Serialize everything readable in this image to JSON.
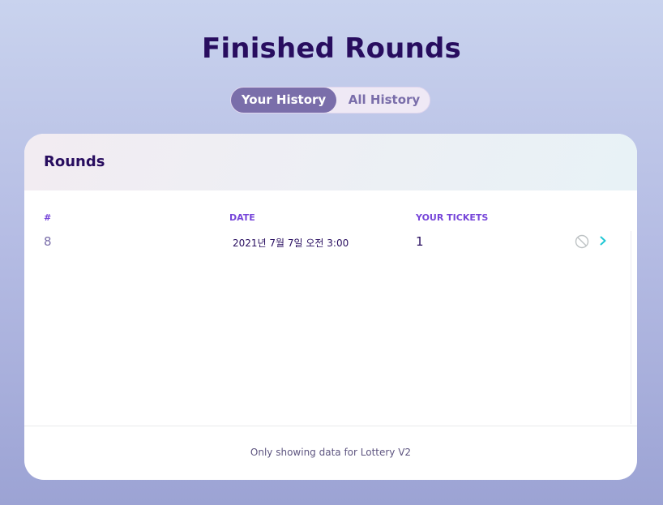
{
  "page": {
    "title": "Finished Rounds"
  },
  "toggle": {
    "active": "Your History",
    "inactive": "All History"
  },
  "card": {
    "header": "Rounds",
    "columns": {
      "num": "#",
      "date": "DATE",
      "tickets": "YOUR TICKETS"
    },
    "rows": [
      {
        "num": "8",
        "date": "2021년 7월 7일 오전 3:00",
        "tickets": "1"
      }
    ],
    "footer": "Only showing data for Lottery V2"
  },
  "colors": {
    "title": "#280d5f",
    "accent": "#7645d9",
    "toggle_active": "#7a6eaa",
    "chevron": "#1fc7d4",
    "disabled_icon": "#bdc2c4"
  },
  "icons": {
    "row_status": "ban-icon",
    "row_open": "chevron-right-icon"
  }
}
